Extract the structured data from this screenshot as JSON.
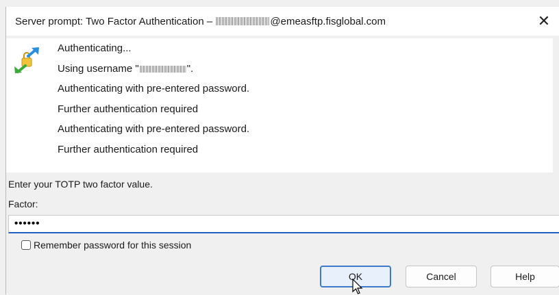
{
  "window": {
    "title_prefix": "Server prompt: Two Factor Authentication – ",
    "title_suffix": "@emeasftp.fisglobal.com",
    "close_symbol": "✕"
  },
  "log": {
    "icon": "authentication-arrows-lock-icon",
    "line_1": "Authenticating...",
    "line_2_prefix": "Using username \"",
    "line_2_suffix": "\".",
    "line_3": "Authenticating with pre-entered password.",
    "line_4": "Further authentication required",
    "line_5": "Authenticating with pre-entered password.",
    "line_6": "Further authentication required"
  },
  "form": {
    "prompt": "Enter your TOTP two factor value.",
    "factor_label": "Factor:",
    "factor_value": "••••••",
    "remember_label": "Remember password for this session",
    "remember_checked": false
  },
  "buttons": {
    "ok": "OK",
    "cancel": "Cancel",
    "help": "Help"
  },
  "colors": {
    "accent": "#1f5fbf",
    "ok_border": "#3d78c9"
  }
}
